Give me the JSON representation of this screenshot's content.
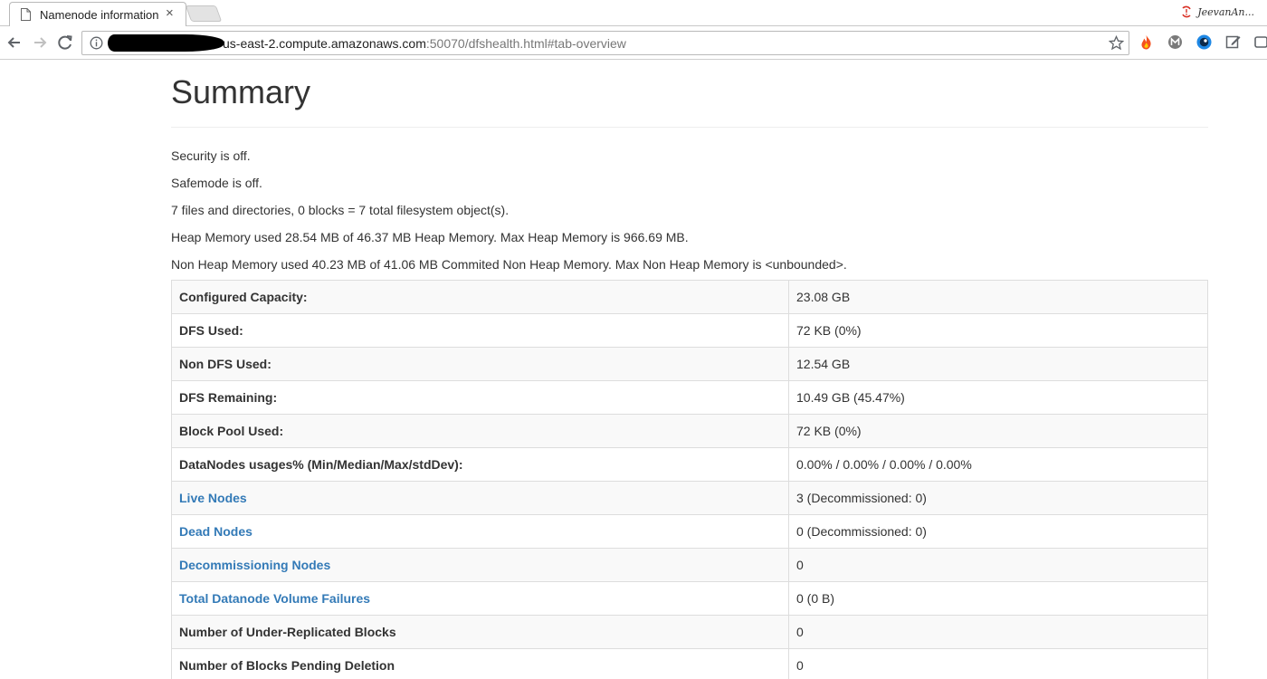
{
  "browser": {
    "tab_title": "Namenode information",
    "tab_close": "×",
    "profile_name": "JeevanAn...",
    "url_host": "us-east-2.compute.amazonaws.com",
    "url_path": ":50070/dfshealth.html#tab-overview"
  },
  "page": {
    "title": "Summary",
    "lines": [
      "Security is off.",
      "Safemode is off.",
      "7 files and directories, 0 blocks = 7 total filesystem object(s).",
      "Heap Memory used 28.54 MB of 46.37 MB Heap Memory. Max Heap Memory is 966.69 MB.",
      "Non Heap Memory used 40.23 MB of 41.06 MB Commited Non Heap Memory. Max Non Heap Memory is <unbounded>."
    ],
    "rows": [
      {
        "key": "Configured Capacity:",
        "value": "23.08 GB"
      },
      {
        "key": "DFS Used:",
        "value": "72 KB (0%)"
      },
      {
        "key": "Non DFS Used:",
        "value": "12.54 GB"
      },
      {
        "key": "DFS Remaining:",
        "value": "10.49 GB (45.47%)"
      },
      {
        "key": "Block Pool Used:",
        "value": "72 KB (0%)"
      },
      {
        "key": "DataNodes usages% (Min/Median/Max/stdDev):",
        "value": "0.00% / 0.00% / 0.00% / 0.00%"
      },
      {
        "key": "Live Nodes",
        "value": "3 (Decommissioned: 0)"
      },
      {
        "key": "Dead Nodes",
        "value": "0 (Decommissioned: 0)"
      },
      {
        "key": "Decommissioning Nodes",
        "value": "0"
      },
      {
        "key": "Total Datanode Volume Failures",
        "value": "0 (0 B)"
      },
      {
        "key": "Number of Under-Replicated Blocks",
        "value": "0"
      },
      {
        "key": "Number of Blocks Pending Deletion",
        "value": "0"
      }
    ]
  },
  "colors": {
    "link": "#337ab7",
    "text": "#333333",
    "stripe": "#f9f9f9",
    "border": "#dddddd"
  }
}
